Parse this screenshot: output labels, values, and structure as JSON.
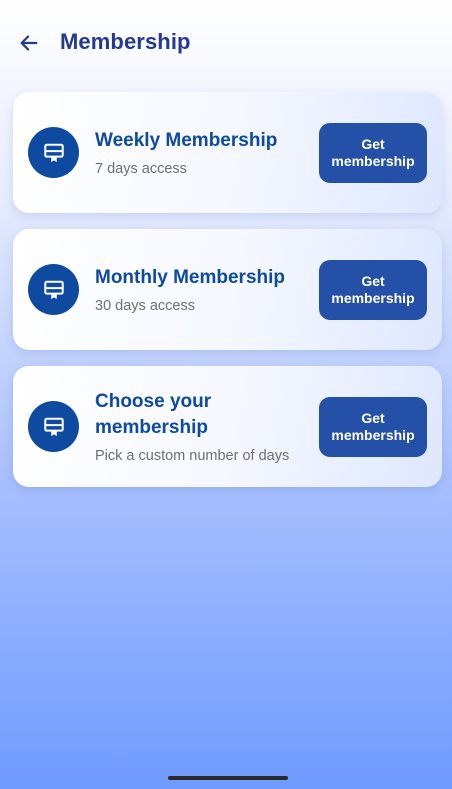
{
  "header": {
    "title": "Membership",
    "back_icon": "arrow-left-icon"
  },
  "colors": {
    "primary": "#253a8f",
    "accent": "#0e4aa0",
    "button": "#2550a7"
  },
  "cards": [
    {
      "title": "Weekly Membership",
      "subtitle": "7 days access",
      "button_label": "Get membership",
      "icon": "membership-card-icon"
    },
    {
      "title": "Monthly Membership",
      "subtitle": "30 days access",
      "button_label": "Get membership",
      "icon": "membership-card-icon"
    },
    {
      "title": "Choose your membership",
      "subtitle": "Pick a custom number of days",
      "button_label": "Get membership",
      "icon": "membership-card-icon"
    }
  ]
}
